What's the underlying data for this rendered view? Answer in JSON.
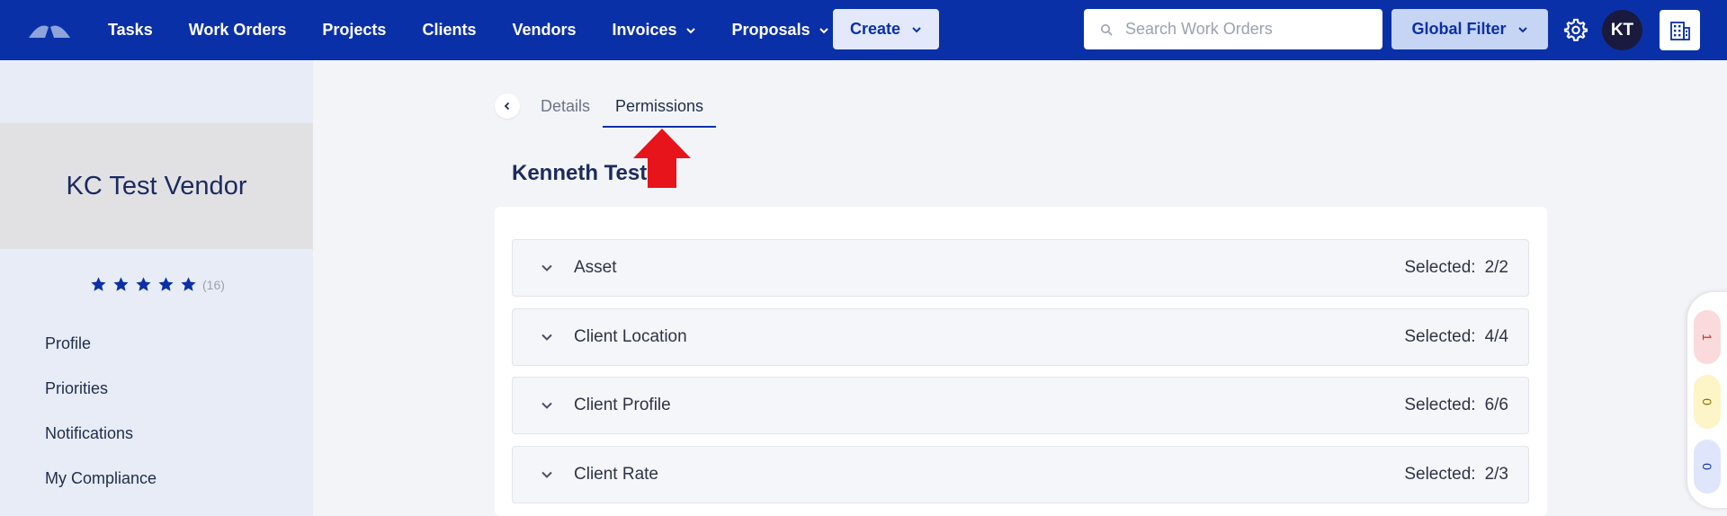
{
  "nav": {
    "items": [
      {
        "label": "Tasks",
        "dropdown": false
      },
      {
        "label": "Work Orders",
        "dropdown": false
      },
      {
        "label": "Projects",
        "dropdown": false
      },
      {
        "label": "Clients",
        "dropdown": false
      },
      {
        "label": "Vendors",
        "dropdown": false
      },
      {
        "label": "Invoices",
        "dropdown": true
      },
      {
        "label": "Proposals",
        "dropdown": true
      }
    ],
    "create_label": "Create",
    "search_placeholder": "Search Work Orders",
    "global_filter_label": "Global Filter",
    "avatar_initials": "KT"
  },
  "sidebar": {
    "vendor_name": "KC Test Vendor",
    "rating_stars": 5,
    "rating_count": "(16)",
    "menu": [
      "Profile",
      "Priorities",
      "Notifications",
      "My Compliance"
    ]
  },
  "tabs": {
    "details": "Details",
    "permissions": "Permissions",
    "active": "permissions"
  },
  "user_title": "Kenneth Test",
  "permissions": [
    {
      "name": "Asset",
      "selected_label": "Selected:",
      "selected_value": "2/2"
    },
    {
      "name": "Client Location",
      "selected_label": "Selected:",
      "selected_value": "4/4"
    },
    {
      "name": "Client Profile",
      "selected_label": "Selected:",
      "selected_value": "6/6"
    },
    {
      "name": "Client Rate",
      "selected_label": "Selected:",
      "selected_value": "2/3"
    }
  ],
  "float_badges": [
    {
      "value": "1",
      "color": "#fadadd",
      "text_color": "#c0392b"
    },
    {
      "value": "0",
      "color": "#fdf4c7",
      "text_color": "#8a6d00"
    },
    {
      "value": "0",
      "color": "#dfe6fb",
      "text_color": "#0a30a8"
    }
  ],
  "colors": {
    "brand": "#0a30a8",
    "annotation_arrow": "#e8141b"
  }
}
